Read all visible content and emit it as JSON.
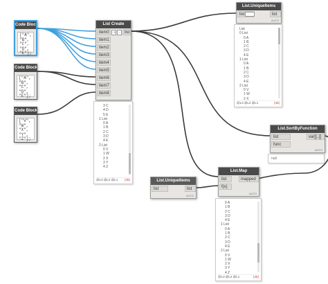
{
  "code_blocks": [
    {
      "title": "Code Block",
      "code": "[\"A\",\n\"B\",\n\"C\",\n\"D\",\n\"E\"];"
    },
    {
      "title": "Code Block",
      "code": "[\"A\",\n\"B\",\n\"C\",\n\"D\",\n\"E\"];"
    },
    {
      "title": "Code Block",
      "code": "[\"V\",\n\"W\",\n\"X\",\n\"Y\",\n\"Z\"];"
    }
  ],
  "list_create": {
    "title": "List Create",
    "inputs": [
      "item0",
      "item1",
      "item2",
      "item3",
      "item4",
      "item5",
      "item6",
      "item7",
      "item8"
    ],
    "output": "list",
    "add_label": "+",
    "remove_label": "-",
    "preview": {
      "lines": [
        "3 C",
        "4 D",
        "5 E",
        "1 List",
        "0 A",
        "1 B",
        "2 C",
        "3 D",
        "4 E",
        "2 List",
        "0 V",
        "1 W",
        "2 X",
        "3 Y",
        "4 Z"
      ],
      "levels": "@L3 @L2 @L1",
      "count": "{45}"
    }
  },
  "unique_top": {
    "title": "List.UniqueItems",
    "inputs": [
      "list"
    ],
    "output": "list",
    "auto": "AUTO",
    "preview": {
      "lines": [
        "List",
        "0 List",
        "0 A",
        "1 B",
        "2 C",
        "3 D",
        "4 E",
        "1 List",
        "0 A",
        "1 B",
        "2 C",
        "3 D",
        "4 E",
        "2 List",
        "0 V",
        "1 W",
        "2 X",
        "3 Y",
        "4 Z"
      ],
      "levels": "@L3 @L2 @L1",
      "count": "{45}"
    }
  },
  "sort_by_function": {
    "title": "List.SortByFunction",
    "inputs": [
      "list",
      "func"
    ],
    "output": "var[]..[]",
    "auto": "AUTO",
    "preview_text": "null"
  },
  "unique_bottom": {
    "title": "List.UniqueItems",
    "inputs": [
      "list"
    ],
    "output": "list",
    "auto": "AUTO"
  },
  "list_map": {
    "title": "List.Map",
    "inputs": [
      "list",
      "f(x)"
    ],
    "output": "mapped",
    "auto": "AUTO",
    "preview": {
      "lines": [
        "0 A",
        "1 B",
        "2 C",
        "3 D",
        "4 E",
        "1 List",
        "0 A",
        "1 B",
        "2 C",
        "3 D",
        "4 E",
        "2 List",
        "0 V",
        "1 W",
        "2 X",
        "3 Y",
        "4 Z"
      ],
      "levels": "@L3 @L2 @L1",
      "count": "{45}"
    }
  },
  "colors": {
    "wire_selected": "#3fa0e0",
    "wire_default": "#3a3a3a",
    "node_header": "#4a4a4a",
    "node_body": "#e8e6e3",
    "count_text": "#c0392b"
  }
}
